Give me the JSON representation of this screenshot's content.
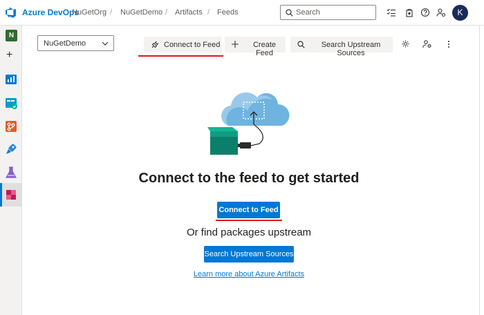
{
  "topbar": {
    "brand": "Azure DevOps",
    "breadcrumbs": [
      "NuGetOrg",
      "NuGetDemo",
      "Artifacts",
      "Feeds"
    ],
    "separator": "/",
    "search_placeholder": "Search",
    "avatar_initial": "K"
  },
  "rail": {
    "project_initial": "N",
    "add_label": "+"
  },
  "toolbar": {
    "feed_selector": "NuGetDemo",
    "connect_label": "Connect to Feed",
    "create_label": "Create Feed",
    "search_upstream_label": "Search Upstream Sources"
  },
  "main": {
    "headline": "Connect to the feed to get started",
    "primary_button": "Connect to Feed",
    "subheadline": "Or find packages upstream",
    "secondary_button": "Search Upstream Sources",
    "learn_more_link": "Learn more about Azure Artifacts"
  },
  "colors": {
    "accent": "#0078d4",
    "annotation_red": "#e0161b"
  }
}
